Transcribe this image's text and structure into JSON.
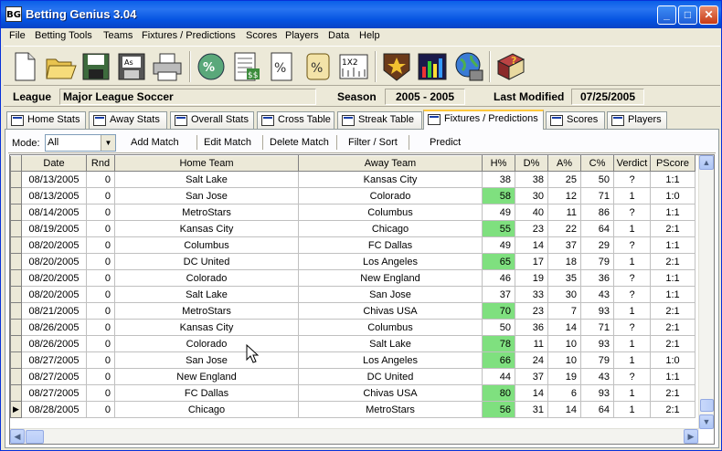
{
  "window": {
    "title": "Betting Genius 3.04",
    "logo": "BG"
  },
  "menu": [
    "File",
    "Betting Tools",
    "Teams",
    "Fixtures / Predictions",
    "Scores",
    "Players",
    "Data",
    "Help"
  ],
  "toolbar_icons": [
    "new-document-icon",
    "open-folder-icon",
    "save-disk-icon",
    "save-as-icon",
    "print-icon",
    "percentage-calculator-icon",
    "odds-sheet-icon",
    "percent-document-icon",
    "scroll-percent-icon",
    "1x2-grid-icon",
    "star-badge-icon",
    "bar-chart-icon",
    "globe-computer-icon",
    "help-book-icon"
  ],
  "info": {
    "league_label": "League",
    "league_value": "Major League Soccer",
    "season_label": "Season",
    "season_value": "2005 - 2005",
    "modified_label": "Last Modified",
    "modified_value": "07/25/2005"
  },
  "tabs": [
    "Home Stats",
    "Away Stats",
    "Overall Stats",
    "Cross Table",
    "Streak Table",
    "Fixtures / Predictions",
    "Scores",
    "Players"
  ],
  "active_tab": "Fixtures / Predictions",
  "actions": {
    "mode_label": "Mode:",
    "mode_value": "All",
    "buttons": [
      "Add Match",
      "Edit Match",
      "Delete Match",
      "Filter / Sort",
      "Predict"
    ]
  },
  "grid": {
    "columns": [
      "Date",
      "Rnd",
      "Home Team",
      "Away Team",
      "H%",
      "D%",
      "A%",
      "C%",
      "Verdict",
      "PScore"
    ],
    "highlight_color": "#7fe07f",
    "rows": [
      {
        "date": "08/13/2005",
        "rnd": "0",
        "home": "Salt Lake",
        "away": "Kansas City",
        "h": "38",
        "d": "38",
        "a": "25",
        "c": "50",
        "verdict": "?",
        "pscore": "1:1",
        "hl": false
      },
      {
        "date": "08/13/2005",
        "rnd": "0",
        "home": "San Jose",
        "away": "Colorado",
        "h": "58",
        "d": "30",
        "a": "12",
        "c": "71",
        "verdict": "1",
        "pscore": "1:0",
        "hl": true
      },
      {
        "date": "08/14/2005",
        "rnd": "0",
        "home": "MetroStars",
        "away": "Columbus",
        "h": "49",
        "d": "40",
        "a": "11",
        "c": "86",
        "verdict": "?",
        "pscore": "1:1",
        "hl": false
      },
      {
        "date": "08/19/2005",
        "rnd": "0",
        "home": "Kansas City",
        "away": "Chicago",
        "h": "55",
        "d": "23",
        "a": "22",
        "c": "64",
        "verdict": "1",
        "pscore": "2:1",
        "hl": true
      },
      {
        "date": "08/20/2005",
        "rnd": "0",
        "home": "Columbus",
        "away": "FC Dallas",
        "h": "49",
        "d": "14",
        "a": "37",
        "c": "29",
        "verdict": "?",
        "pscore": "1:1",
        "hl": false
      },
      {
        "date": "08/20/2005",
        "rnd": "0",
        "home": "DC United",
        "away": "Los Angeles",
        "h": "65",
        "d": "17",
        "a": "18",
        "c": "79",
        "verdict": "1",
        "pscore": "2:1",
        "hl": true
      },
      {
        "date": "08/20/2005",
        "rnd": "0",
        "home": "Colorado",
        "away": "New England",
        "h": "46",
        "d": "19",
        "a": "35",
        "c": "36",
        "verdict": "?",
        "pscore": "1:1",
        "hl": false
      },
      {
        "date": "08/20/2005",
        "rnd": "0",
        "home": "Salt Lake",
        "away": "San Jose",
        "h": "37",
        "d": "33",
        "a": "30",
        "c": "43",
        "verdict": "?",
        "pscore": "1:1",
        "hl": false
      },
      {
        "date": "08/21/2005",
        "rnd": "0",
        "home": "MetroStars",
        "away": "Chivas USA",
        "h": "70",
        "d": "23",
        "a": "7",
        "c": "93",
        "verdict": "1",
        "pscore": "2:1",
        "hl": true
      },
      {
        "date": "08/26/2005",
        "rnd": "0",
        "home": "Kansas City",
        "away": "Columbus",
        "h": "50",
        "d": "36",
        "a": "14",
        "c": "71",
        "verdict": "?",
        "pscore": "2:1",
        "hl": false
      },
      {
        "date": "08/26/2005",
        "rnd": "0",
        "home": "Colorado",
        "away": "Salt Lake",
        "h": "78",
        "d": "11",
        "a": "10",
        "c": "93",
        "verdict": "1",
        "pscore": "2:1",
        "hl": true
      },
      {
        "date": "08/27/2005",
        "rnd": "0",
        "home": "San Jose",
        "away": "Los Angeles",
        "h": "66",
        "d": "24",
        "a": "10",
        "c": "79",
        "verdict": "1",
        "pscore": "1:0",
        "hl": true
      },
      {
        "date": "08/27/2005",
        "rnd": "0",
        "home": "New England",
        "away": "DC United",
        "h": "44",
        "d": "37",
        "a": "19",
        "c": "43",
        "verdict": "?",
        "pscore": "1:1",
        "hl": false
      },
      {
        "date": "08/27/2005",
        "rnd": "0",
        "home": "FC Dallas",
        "away": "Chivas USA",
        "h": "80",
        "d": "14",
        "a": "6",
        "c": "93",
        "verdict": "1",
        "pscore": "2:1",
        "hl": true
      },
      {
        "date": "08/28/2005",
        "rnd": "0",
        "home": "Chicago",
        "away": "MetroStars",
        "h": "56",
        "d": "31",
        "a": "14",
        "c": "64",
        "verdict": "1",
        "pscore": "2:1",
        "hl": true
      }
    ],
    "current_row_marker": "▶"
  }
}
